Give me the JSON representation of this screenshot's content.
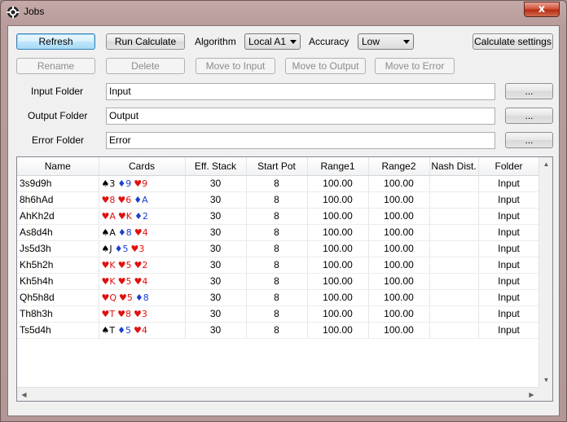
{
  "window": {
    "title": "Jobs",
    "close_glyph": "x"
  },
  "toolbar": {
    "refresh": "Refresh",
    "run_calculate": "Run Calculate",
    "algorithm_label": "Algorithm",
    "algorithm_value": "Local A1",
    "accuracy_label": "Accuracy",
    "accuracy_value": "Low",
    "calc_settings": "Calculate settings",
    "rename": "Rename",
    "delete": "Delete",
    "move_input": "Move to Input",
    "move_output": "Move to Output",
    "move_error": "Move to Error"
  },
  "folders": {
    "input_label": "Input Folder",
    "input_value": "Input",
    "output_label": "Output Folder",
    "output_value": "Output",
    "error_label": "Error Folder",
    "error_value": "Error",
    "browse": "..."
  },
  "table": {
    "columns": [
      "Name",
      "Cards",
      "Eff. Stack",
      "Start Pot",
      "Range1",
      "Range2",
      "Nash Dist.",
      "Folder"
    ],
    "rows": [
      {
        "name": "3s9d9h",
        "cards": [
          [
            "♠",
            "3",
            "#000"
          ],
          [
            "♦",
            "9",
            "#1a3fd0"
          ],
          [
            "♥",
            "9",
            "#e01010"
          ]
        ],
        "stack": "30",
        "pot": "8",
        "r1": "100.00",
        "r2": "100.00",
        "nash": "",
        "folder": "Input"
      },
      {
        "name": "8h6hAd",
        "cards": [
          [
            "♥",
            "8",
            "#e01010"
          ],
          [
            "♥",
            "6",
            "#e01010"
          ],
          [
            "♦",
            "A",
            "#1a3fd0"
          ]
        ],
        "stack": "30",
        "pot": "8",
        "r1": "100.00",
        "r2": "100.00",
        "nash": "",
        "folder": "Input"
      },
      {
        "name": "AhKh2d",
        "cards": [
          [
            "♥",
            "A",
            "#e01010"
          ],
          [
            "♥",
            "K",
            "#e01010"
          ],
          [
            "♦",
            "2",
            "#1a3fd0"
          ]
        ],
        "stack": "30",
        "pot": "8",
        "r1": "100.00",
        "r2": "100.00",
        "nash": "",
        "folder": "Input"
      },
      {
        "name": "As8d4h",
        "cards": [
          [
            "♠",
            "A",
            "#000"
          ],
          [
            "♦",
            "8",
            "#1a3fd0"
          ],
          [
            "♥",
            "4",
            "#e01010"
          ]
        ],
        "stack": "30",
        "pot": "8",
        "r1": "100.00",
        "r2": "100.00",
        "nash": "",
        "folder": "Input"
      },
      {
        "name": "Js5d3h",
        "cards": [
          [
            "♠",
            "J",
            "#000"
          ],
          [
            "♦",
            "5",
            "#1a3fd0"
          ],
          [
            "♥",
            "3",
            "#e01010"
          ]
        ],
        "stack": "30",
        "pot": "8",
        "r1": "100.00",
        "r2": "100.00",
        "nash": "",
        "folder": "Input"
      },
      {
        "name": "Kh5h2h",
        "cards": [
          [
            "♥",
            "K",
            "#e01010"
          ],
          [
            "♥",
            "5",
            "#e01010"
          ],
          [
            "♥",
            "2",
            "#e01010"
          ]
        ],
        "stack": "30",
        "pot": "8",
        "r1": "100.00",
        "r2": "100.00",
        "nash": "",
        "folder": "Input"
      },
      {
        "name": "Kh5h4h",
        "cards": [
          [
            "♥",
            "K",
            "#e01010"
          ],
          [
            "♥",
            "5",
            "#e01010"
          ],
          [
            "♥",
            "4",
            "#e01010"
          ]
        ],
        "stack": "30",
        "pot": "8",
        "r1": "100.00",
        "r2": "100.00",
        "nash": "",
        "folder": "Input"
      },
      {
        "name": "Qh5h8d",
        "cards": [
          [
            "♥",
            "Q",
            "#e01010"
          ],
          [
            "♥",
            "5",
            "#e01010"
          ],
          [
            "♦",
            "8",
            "#1a3fd0"
          ]
        ],
        "stack": "30",
        "pot": "8",
        "r1": "100.00",
        "r2": "100.00",
        "nash": "",
        "folder": "Input"
      },
      {
        "name": "Th8h3h",
        "cards": [
          [
            "♥",
            "T",
            "#e01010"
          ],
          [
            "♥",
            "8",
            "#e01010"
          ],
          [
            "♥",
            "3",
            "#e01010"
          ]
        ],
        "stack": "30",
        "pot": "8",
        "r1": "100.00",
        "r2": "100.00",
        "nash": "",
        "folder": "Input"
      },
      {
        "name": "Ts5d4h",
        "cards": [
          [
            "♠",
            "T",
            "#000"
          ],
          [
            "♦",
            "5",
            "#1a3fd0"
          ],
          [
            "♥",
            "4",
            "#e01010"
          ]
        ],
        "stack": "30",
        "pot": "8",
        "r1": "100.00",
        "r2": "100.00",
        "nash": "",
        "folder": "Input"
      }
    ]
  }
}
